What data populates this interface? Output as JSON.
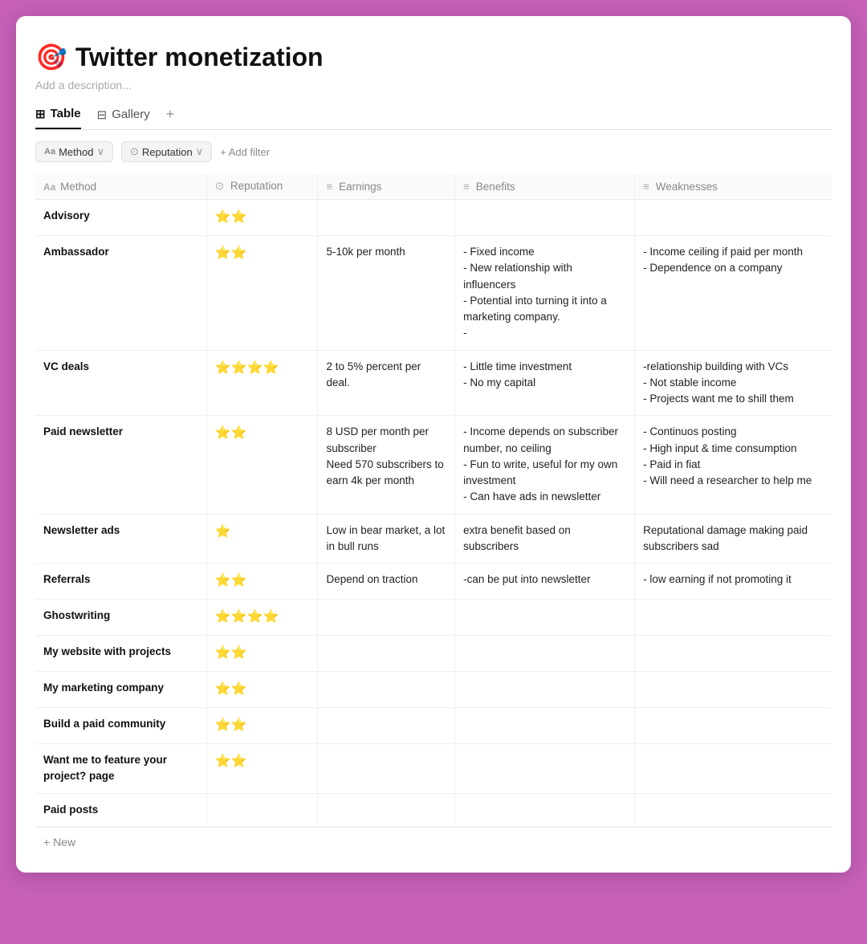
{
  "page": {
    "emoji": "🎯",
    "title": "Twitter monetization",
    "description": "Add a description...",
    "tabs": [
      {
        "id": "table",
        "label": "Table",
        "icon": "⊞",
        "active": true
      },
      {
        "id": "gallery",
        "label": "Gallery",
        "icon": "⊟",
        "active": false
      }
    ],
    "tab_add": "+",
    "filters": [
      {
        "id": "method",
        "label": "Method",
        "prefix": "Aa"
      },
      {
        "id": "reputation",
        "label": "Reputation",
        "prefix": "⊙"
      }
    ],
    "add_filter_label": "+ Add filter"
  },
  "table": {
    "columns": [
      {
        "id": "method",
        "label": "Method",
        "icon": "Aa"
      },
      {
        "id": "reputation",
        "label": "Reputation",
        "icon": "⊙"
      },
      {
        "id": "earnings",
        "label": "Earnings",
        "icon": "≡"
      },
      {
        "id": "benefits",
        "label": "Benefits",
        "icon": "≡"
      },
      {
        "id": "weaknesses",
        "label": "Weaknesses",
        "icon": "≡"
      }
    ],
    "rows": [
      {
        "method": "Advisory",
        "reputation": "⭐⭐",
        "earnings": "",
        "benefits": "",
        "weaknesses": ""
      },
      {
        "method": "Ambassador",
        "reputation": "⭐⭐",
        "earnings": "5-10k per month",
        "benefits": "- Fixed income\n- New relationship with influencers\n- Potential into turning it into a marketing company.\n-",
        "weaknesses": "- Income ceiling if paid per month\n- Dependence on a company"
      },
      {
        "method": "VC deals",
        "reputation": "⭐⭐⭐⭐",
        "earnings": "2 to 5% percent per deal.",
        "benefits": "- Little time investment\n- No my capital",
        "weaknesses": "-relationship building with VCs\n- Not stable income\n- Projects want me to shill them"
      },
      {
        "method": "Paid newsletter",
        "reputation": "⭐⭐",
        "earnings": "8 USD per month per subscriber\nNeed 570 subscribers to earn 4k per month",
        "benefits": "- Income depends on subscriber number, no ceiling\n- Fun to write, useful for my own investment\n- Can have ads in newsletter",
        "weaknesses": "- Continuos posting\n- High input & time consumption\n- Paid in fiat\n- Will need a researcher to help me"
      },
      {
        "method": "Newsletter ads",
        "reputation": "⭐",
        "earnings": "Low in bear market, a lot in bull runs",
        "benefits": "extra benefit based on subscribers",
        "weaknesses": "Reputational damage making paid subscribers sad"
      },
      {
        "method": "Referrals",
        "reputation": "⭐⭐",
        "earnings": "Depend on traction",
        "benefits": "-can be put into newsletter",
        "weaknesses": "- low earning if not promoting it"
      },
      {
        "method": "Ghostwriting",
        "reputation": "⭐⭐⭐⭐",
        "earnings": "",
        "benefits": "",
        "weaknesses": ""
      },
      {
        "method": "My website with projects",
        "reputation": "⭐⭐",
        "earnings": "",
        "benefits": "",
        "weaknesses": ""
      },
      {
        "method": "My marketing company",
        "reputation": "⭐⭐",
        "earnings": "",
        "benefits": "",
        "weaknesses": ""
      },
      {
        "method": "Build a paid community",
        "reputation": "⭐⭐",
        "earnings": "",
        "benefits": "",
        "weaknesses": ""
      },
      {
        "method": "Want me to feature your project? page",
        "reputation": "⭐⭐",
        "earnings": "",
        "benefits": "",
        "weaknesses": ""
      },
      {
        "method": "Paid posts",
        "reputation": "",
        "earnings": "",
        "benefits": "",
        "weaknesses": ""
      }
    ],
    "new_row_label": "+ New"
  }
}
